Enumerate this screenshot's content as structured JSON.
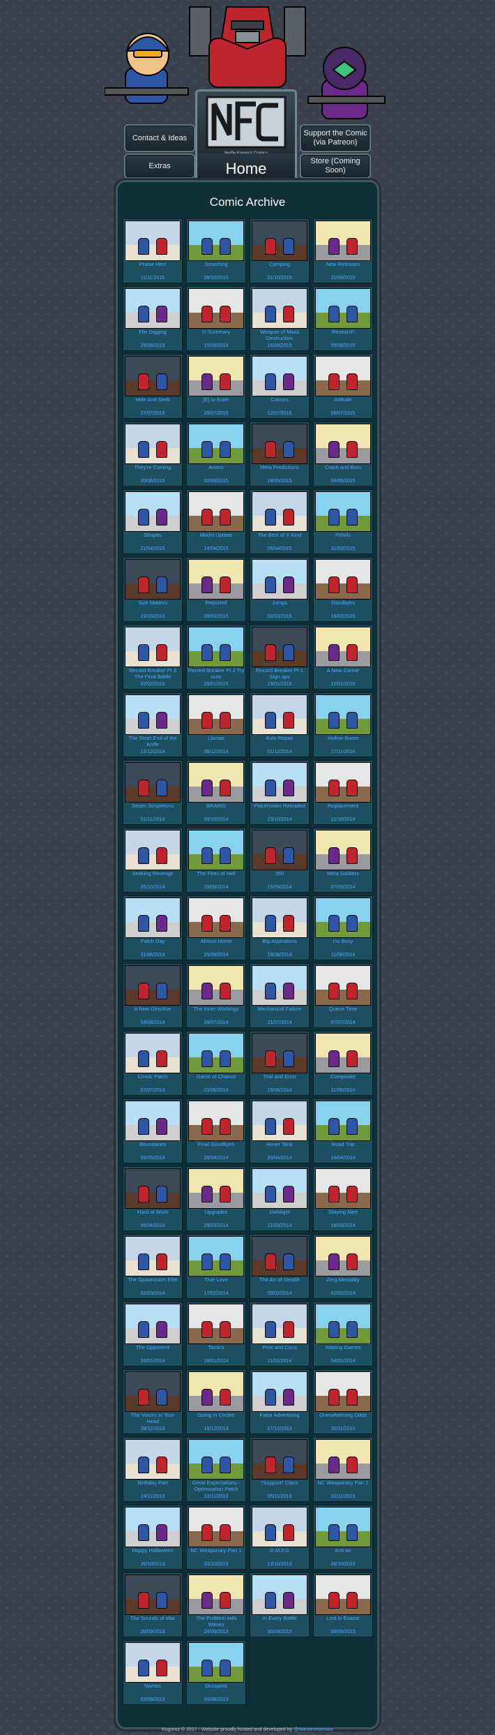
{
  "nav": {
    "contact": "Contact & Ideas",
    "support": "Support the Comic\n(via Patreon)",
    "extras": "Extras",
    "store": "Store (Coming Soon)",
    "home": "Home"
  },
  "logo": {
    "letters": "NFC",
    "tagline": "Nerfie Kogeroz Comics"
  },
  "archive_title": "Comic Archive",
  "comics": [
    {
      "n": "",
      "t": "Praise Him!",
      "d": "11/11/2015"
    },
    {
      "n": "",
      "t": "Smashing",
      "d": "28/10/2015"
    },
    {
      "n": "",
      "t": "Camping",
      "d": "01/10/2015"
    },
    {
      "n": "",
      "t": "New Releases",
      "d": "21/09/2015"
    },
    {
      "n": "",
      "t": "File Digging",
      "d": "25/08/2015"
    },
    {
      "n": "",
      "t": "In Summary",
      "d": "15/08/2015"
    },
    {
      "n": "",
      "t": "Weapon of Mass Destruction",
      "d": "16/08/2015"
    },
    {
      "n": "",
      "t": "Research",
      "d": "05/08/2015"
    },
    {
      "n": "",
      "t": "Hide And Seek",
      "d": "27/07/2015"
    },
    {
      "n": "",
      "t": "[E] to Enter",
      "d": "26/07/2015"
    },
    {
      "n": "",
      "t": "Colours",
      "d": "12/07/2015"
    },
    {
      "n": "",
      "t": "Attitude",
      "d": "06/07/2015"
    },
    {
      "n": "",
      "t": "They're Coming",
      "d": "20/06/2015"
    },
    {
      "n": "",
      "t": "Ammo",
      "d": "02/06/2015"
    },
    {
      "n": "",
      "t": "Meta Predictions",
      "d": "18/05/2015"
    },
    {
      "n": "",
      "t": "Crash and Burn",
      "d": "04/05/2015"
    },
    {
      "n": "",
      "t": "Shapes",
      "d": "21/04/2015"
    },
    {
      "n": "",
      "t": "Model Update",
      "d": "14/04/2015"
    },
    {
      "n": "",
      "t": "The Best of X Kind",
      "d": "06/04/2015"
    },
    {
      "n": "",
      "t": "Pitfalls",
      "d": "31/03/2015"
    },
    {
      "n": "",
      "t": "Size Matters",
      "d": "23/03/2015"
    },
    {
      "n": "",
      "t": "Reported",
      "d": "09/03/2015"
    },
    {
      "n": "",
      "t": "Jumps",
      "d": "02/03/2015"
    },
    {
      "n": "",
      "t": "Goodbyes",
      "d": "16/02/2015"
    },
    {
      "n": "",
      "t": "Record Breaker Pt 3 The Final Battle",
      "d": "02/02/2015"
    },
    {
      "n": "",
      "t": "Record Breaker Pt 2 Try outs",
      "d": "26/01/2015"
    },
    {
      "n": "",
      "t": "Record Breaker Pt 1 Sign ups",
      "d": "19/01/2015"
    },
    {
      "n": "",
      "t": "A New Corner",
      "d": "12/01/2015"
    },
    {
      "n": "",
      "t": "The Short End of the Knife",
      "d": "15/12/2014"
    },
    {
      "n": "",
      "t": "Llamas",
      "d": "08/12/2014"
    },
    {
      "n": "",
      "t": "Auto Repair",
      "d": "01/12/2014"
    },
    {
      "n": "",
      "t": "Hollow Boom",
      "d": "17/11/2014"
    },
    {
      "n": "",
      "t": "Seven Simpletons",
      "d": "01/11/2014"
    },
    {
      "n": "",
      "t": "BRAINS",
      "d": "30/10/2014"
    },
    {
      "n": "",
      "t": "Placeholder Reloaded",
      "d": "23/10/2014"
    },
    {
      "n": "",
      "t": "Replacement",
      "d": "11/10/2014"
    },
    {
      "n": "",
      "t": "Seeking Revenge",
      "d": "05/10/2014"
    },
    {
      "n": "",
      "t": "The Fires of Hell",
      "d": "29/09/2014"
    },
    {
      "n": "",
      "t": "360",
      "d": "15/09/2014"
    },
    {
      "n": "",
      "t": "Meta Soldiers",
      "d": "07/09/2014"
    },
    {
      "n": "",
      "t": "Patch Day",
      "d": "31/08/2014"
    },
    {
      "n": "",
      "t": "Almost Home",
      "d": "25/08/2014"
    },
    {
      "n": "",
      "t": "Big Aspirations",
      "d": "18/08/2014"
    },
    {
      "n": "",
      "t": "I'm Busy",
      "d": "11/08/2014"
    },
    {
      "n": "",
      "t": "A New Directive",
      "d": "04/08/2014"
    },
    {
      "n": "",
      "t": "The Inner Workings",
      "d": "28/07/2014"
    },
    {
      "n": "",
      "t": "Mechanical Failure",
      "d": "21/07/2014"
    },
    {
      "n": "",
      "t": "Queue Time",
      "d": "07/07/2014"
    },
    {
      "n": "",
      "t": "Comic Patch",
      "d": "07/07/2014"
    },
    {
      "n": "",
      "t": "Game of Chance",
      "d": "21/06/2014"
    },
    {
      "n": "",
      "t": "Trial and Error",
      "d": "15/06/2014"
    },
    {
      "n": "",
      "t": "Composite",
      "d": "11/06/2014"
    },
    {
      "n": "",
      "t": "Boundaries",
      "d": "05/05/2014"
    },
    {
      "n": "",
      "t": "Final Goodbyes",
      "d": "28/04/2014"
    },
    {
      "n": "",
      "t": "Hover Tank",
      "d": "20/04/2014"
    },
    {
      "n": "",
      "t": "Road Trip",
      "d": "14/04/2014"
    },
    {
      "n": "",
      "t": "Hard at Work",
      "d": "06/04/2014"
    },
    {
      "n": "",
      "t": "Upgrades",
      "d": "29/03/2014"
    },
    {
      "n": "",
      "t": "Darklight",
      "d": "21/03/2014"
    },
    {
      "n": "",
      "t": "Staying Alert",
      "d": "16/03/2014"
    },
    {
      "n": "",
      "t": "The Spawnroom Elite",
      "d": "02/03/2014"
    },
    {
      "n": "",
      "t": "True Love",
      "d": "17/02/2014"
    },
    {
      "n": "",
      "t": "The Art of Stealth",
      "d": "09/02/2014"
    },
    {
      "n": "",
      "t": "Zerg Mentality",
      "d": "02/02/2014"
    },
    {
      "n": "",
      "t": "The Opponent",
      "d": "26/01/2014"
    },
    {
      "n": "",
      "t": "Tactics",
      "d": "18/01/2014"
    },
    {
      "n": "",
      "t": "Pros and Cons",
      "d": "11/01/2014"
    },
    {
      "n": "",
      "t": "Waiting Games",
      "d": "04/01/2014"
    },
    {
      "n": "",
      "t": "The Voices in Your Head",
      "d": "28/12/2013"
    },
    {
      "n": "",
      "t": "Going in Circles",
      "d": "16/12/2013"
    },
    {
      "n": "",
      "t": "False Advertising",
      "d": "07/12/2013"
    },
    {
      "n": "",
      "t": "Overwhelming Odds",
      "d": "30/11/2013"
    },
    {
      "n": "",
      "t": "Birthday Part",
      "d": "24/11/2013"
    },
    {
      "n": "",
      "t": "Great Expectations - Optimisation Patch",
      "d": "12/11/2013"
    },
    {
      "n": "",
      "t": "*Support* Class",
      "d": "05/11/2013"
    },
    {
      "n": "",
      "t": "NC Weaponary Part 2",
      "d": "02/11/2013"
    },
    {
      "n": "",
      "t": "Happy Halloween",
      "d": "26/10/2013"
    },
    {
      "n": "",
      "t": "NC Weaponary Part 1",
      "d": "20/10/2013"
    },
    {
      "n": "",
      "t": "O.M.F.G",
      "d": "13/10/2013"
    },
    {
      "n": "",
      "t": "Anti Air",
      "d": "06/10/2013"
    },
    {
      "n": "",
      "t": "The Sounds of War",
      "d": "20/09/2013"
    },
    {
      "n": "",
      "t": "The Problem with Waves",
      "d": "24/09/2013"
    },
    {
      "n": "",
      "t": "In Every Battle",
      "d": "30/09/2013"
    },
    {
      "n": "",
      "t": "Lost in Esamir",
      "d": "08/09/2013"
    },
    {
      "n": "",
      "t": "Names",
      "d": "02/09/2013"
    },
    {
      "n": "",
      "t": "Occupied",
      "d": "30/08/2013"
    }
  ],
  "thumb_palettes": [
    [
      "#c4d7e8",
      "#e8e2d2",
      "#2d56a4",
      "#c0242c"
    ],
    [
      "#86d3f0",
      "#6f9b3a",
      "#2d56a4",
      "#2d56a4"
    ],
    [
      "#3a4a58",
      "#5a3b2a",
      "#c0242c",
      "#2d56a4"
    ],
    [
      "#f2e6b0",
      "#9a9aa0",
      "#6b2a8a",
      "#c0242c"
    ],
    [
      "#b7e0f4",
      "#cfcfcf",
      "#2d56a4",
      "#6b2a8a"
    ],
    [
      "#e6e6e6",
      "#8a6a4a",
      "#c0242c",
      "#c0242c"
    ]
  ],
  "footer": {
    "text": "Kogoroz © 2017 - Website proudly hosted and developed by ",
    "link": "@Nanotronomous"
  }
}
